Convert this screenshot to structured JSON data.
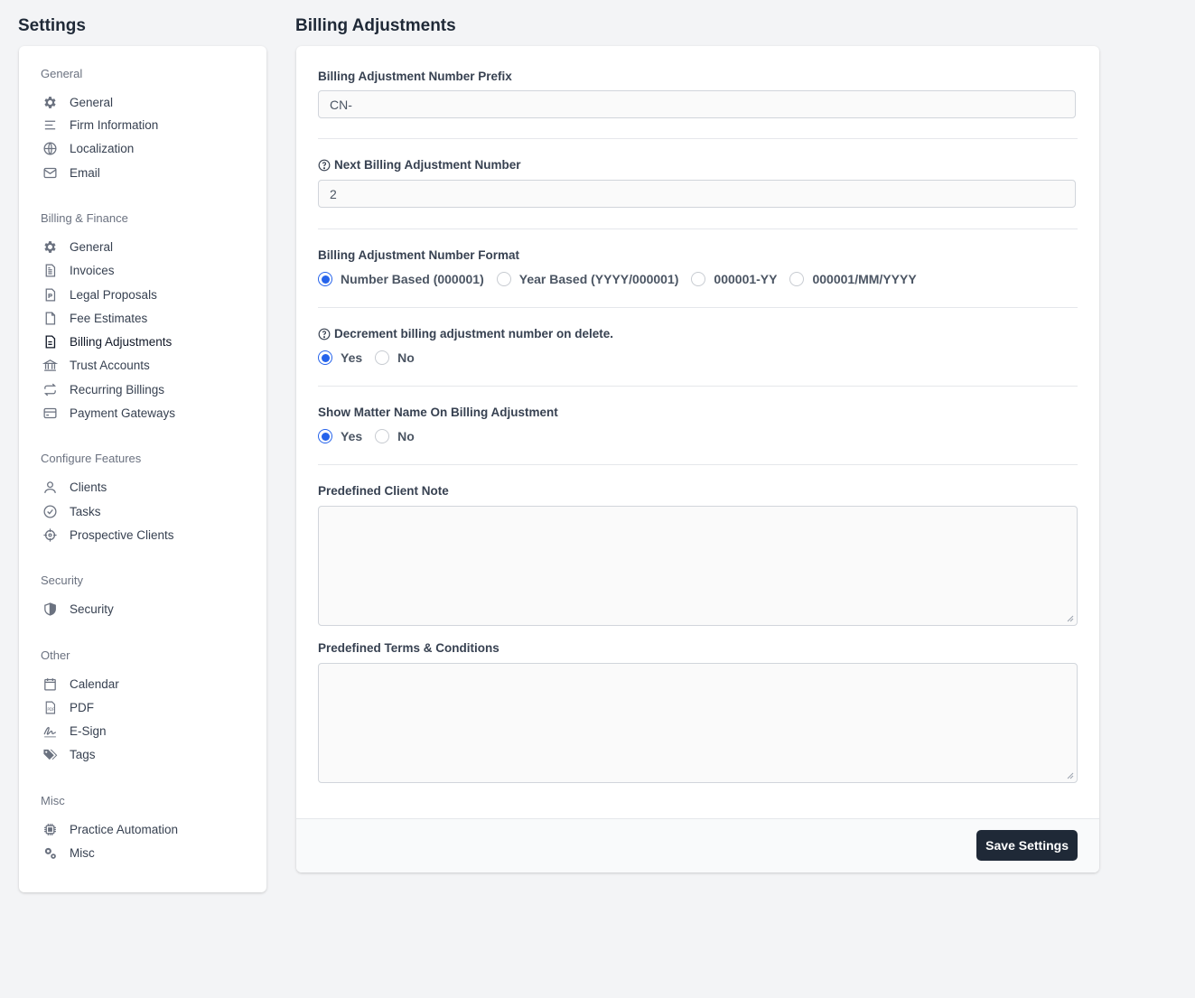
{
  "page": {
    "settings_title": "Settings",
    "main_title": "Billing Adjustments"
  },
  "sidebar": {
    "groups": [
      {
        "title": "General",
        "items": [
          {
            "label": "General",
            "icon": "gear-icon"
          },
          {
            "label": "Firm Information",
            "icon": "lines-icon"
          },
          {
            "label": "Localization",
            "icon": "globe-icon"
          },
          {
            "label": "Email",
            "icon": "envelope-icon"
          }
        ]
      },
      {
        "title": "Billing & Finance",
        "items": [
          {
            "label": "General",
            "icon": "gear-icon"
          },
          {
            "label": "Invoices",
            "icon": "invoice-icon"
          },
          {
            "label": "Legal Proposals",
            "icon": "proposal-icon"
          },
          {
            "label": "Fee Estimates",
            "icon": "document-icon"
          },
          {
            "label": "Billing Adjustments",
            "icon": "document-text-icon",
            "active": true
          },
          {
            "label": "Trust Accounts",
            "icon": "bank-icon"
          },
          {
            "label": "Recurring Billings",
            "icon": "repeat-icon"
          },
          {
            "label": "Payment Gateways",
            "icon": "credit-card-icon"
          }
        ]
      },
      {
        "title": "Configure Features",
        "items": [
          {
            "label": "Clients",
            "icon": "user-icon"
          },
          {
            "label": "Tasks",
            "icon": "check-circle-icon"
          },
          {
            "label": "Prospective Clients",
            "icon": "crosshair-icon"
          }
        ]
      },
      {
        "title": "Security",
        "items": [
          {
            "label": "Security",
            "icon": "shield-icon"
          }
        ]
      },
      {
        "title": "Other",
        "items": [
          {
            "label": "Calendar",
            "icon": "calendar-icon"
          },
          {
            "label": "PDF",
            "icon": "pdf-icon"
          },
          {
            "label": "E-Sign",
            "icon": "signature-icon"
          },
          {
            "label": "Tags",
            "icon": "tags-icon"
          }
        ]
      },
      {
        "title": "Misc",
        "items": [
          {
            "label": "Practice Automation",
            "icon": "chip-icon"
          },
          {
            "label": "Misc",
            "icon": "gears-icon"
          }
        ]
      }
    ]
  },
  "form": {
    "prefix": {
      "label": "Billing Adjustment Number Prefix",
      "value": "CN-"
    },
    "next_number": {
      "label": "Next Billing Adjustment Number",
      "value": "2"
    },
    "format": {
      "label": "Billing Adjustment Number Format",
      "options": [
        "Number Based (000001)",
        "Year Based (YYYY/000001)",
        "000001-YY",
        "000001/MM/YYYY"
      ],
      "selected": "Number Based (000001)"
    },
    "decrement": {
      "label": "Decrement billing adjustment number on delete.",
      "options": [
        "Yes",
        "No"
      ],
      "selected": "Yes"
    },
    "show_matter": {
      "label": "Show Matter Name On Billing Adjustment",
      "options": [
        "Yes",
        "No"
      ],
      "selected": "Yes"
    },
    "client_note": {
      "label": "Predefined Client Note",
      "value": ""
    },
    "terms": {
      "label": "Predefined Terms & Conditions",
      "value": ""
    },
    "save_label": "Save Settings"
  },
  "colors": {
    "accent": "#2563eb",
    "button_bg": "#1f2937",
    "background": "#f3f4f6"
  }
}
